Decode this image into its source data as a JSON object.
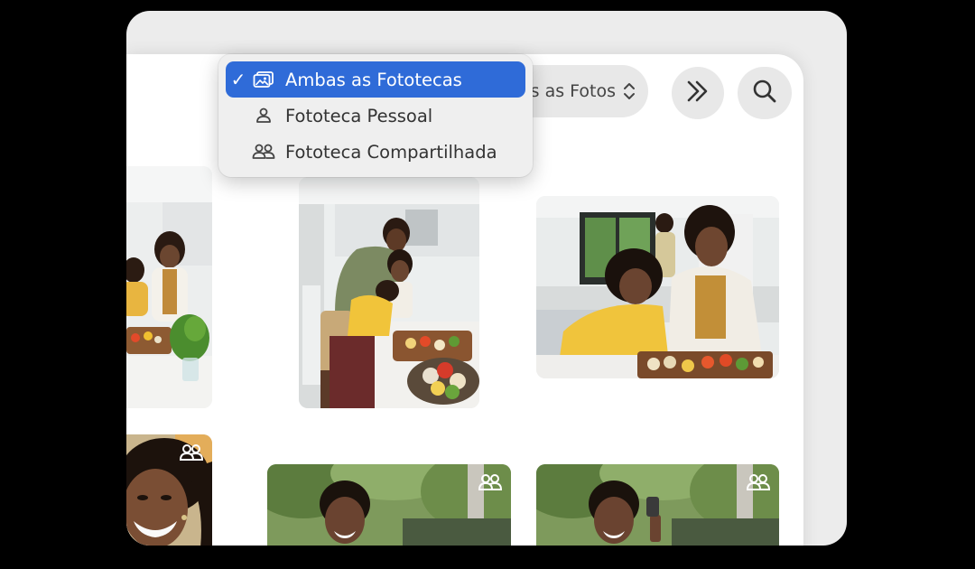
{
  "toolbar": {
    "view_select_label": "s as Fotos"
  },
  "library_menu": {
    "items": [
      {
        "label": "Ambas as Fototecas",
        "icon": "photo-library-icon",
        "selected": true
      },
      {
        "label": "Fototeca Pessoal",
        "icon": "person-icon",
        "selected": false
      },
      {
        "label": "Fototeca Compartilhada",
        "icon": "people-icon",
        "selected": false
      }
    ]
  },
  "photos": [
    {
      "subject": "family cooking in kitchen (cropped left)",
      "shared": false
    },
    {
      "subject": "father hugging son at kitchen counter",
      "shared": false
    },
    {
      "subject": "mother and daughter preparing food",
      "shared": false
    },
    {
      "subject": "smiling woman portrait",
      "shared": true
    },
    {
      "subject": "man outdoors under trees",
      "shared": true
    },
    {
      "subject": "man outdoors holding phone",
      "shared": true
    }
  ],
  "colors": {
    "accent": "#2f6bd8",
    "menu_bg": "#efefef",
    "pill_bg": "#e8e8e8"
  }
}
